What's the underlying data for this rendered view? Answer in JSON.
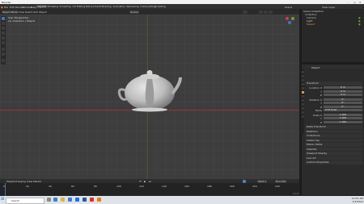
{
  "window": {
    "title": "Blender"
  },
  "menubar": {
    "items": [
      "File",
      "Edit",
      "Render",
      "Window",
      "Help"
    ]
  },
  "workspace_tabs": [
    "Layout",
    "Modeling",
    "Sculpting",
    "UV Editing",
    "Texture Paint",
    "Shading",
    "Animation",
    "Rendering",
    "Compositing",
    "Scripting"
  ],
  "scene": {
    "label": "Scene",
    "layer": "View Layer"
  },
  "viewport_header": {
    "mode": "Object Mode",
    "view": "View",
    "select": "Select",
    "add": "Add",
    "object": "Object",
    "transform": "Global"
  },
  "viewport_info": {
    "line1": "User Perspective",
    "line2": "(1) Collection | Teapot"
  },
  "outliner": {
    "header": "Scene Collection",
    "items": [
      "Collection",
      "Camera",
      "Light",
      "Teapot"
    ]
  },
  "properties": {
    "object_name": "Teapot",
    "section_transform": "Transform",
    "rows": [
      {
        "label": "Location X",
        "value": "0 m"
      },
      {
        "label": "Y",
        "value": "0 m"
      },
      {
        "label": "Z",
        "value": "0 m"
      },
      {
        "label": "Rotation X",
        "value": "0°"
      },
      {
        "label": "Y",
        "value": "0°"
      },
      {
        "label": "Z",
        "value": "0°"
      },
      {
        "label": "Mode",
        "value": "XYZ Euler"
      },
      {
        "label": "Scale X",
        "value": "1.000"
      },
      {
        "label": "Y",
        "value": "1.000"
      },
      {
        "label": "Z",
        "value": "1.000"
      }
    ],
    "sections": [
      "Delta Transform",
      "Relations",
      "Collections",
      "Instancing",
      "Motion Paths",
      "Visibility",
      "Viewport Display",
      "Line Art",
      "Custom Properties"
    ]
  },
  "timeline": {
    "menu": [
      "Playback",
      "Keying",
      "View",
      "Marker"
    ],
    "current_frame": "1",
    "start": "Start 1",
    "end": "End 250",
    "ticks": [
      "0",
      "20",
      "40",
      "60",
      "80",
      "100",
      "120",
      "140",
      "160",
      "180",
      "200",
      "220",
      "240"
    ]
  },
  "statusbar": {
    "version": "3.0.0"
  },
  "taskbar": {
    "search_placeholder": "Search",
    "time": "10:41 AM",
    "date": "1/3/2022"
  }
}
